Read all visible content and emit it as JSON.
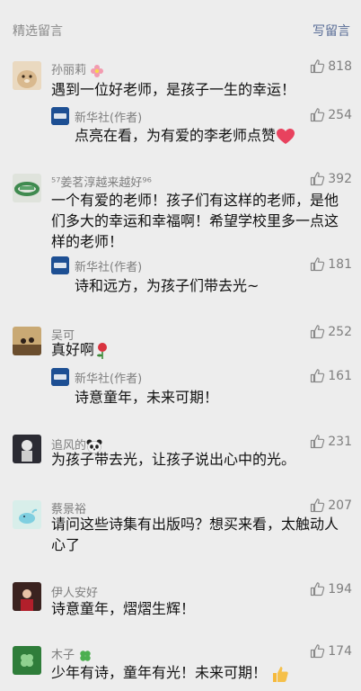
{
  "header": {
    "title": "精选留言",
    "write_label": "写留言"
  },
  "reply_author": "新华社(作者)",
  "comments": [
    {
      "author": "孙丽莉",
      "text": "遇到一位好老师，是孩子一生的幸运！",
      "likes": "818",
      "reply": {
        "text": "点亮在看，为有爱的李老师点赞",
        "likes": "254"
      }
    },
    {
      "author": "⁵⁷姜茗淳越来越好⁹⁶",
      "text": "一个有爱的老师！孩子们有这样的老师，是他们多大的幸运和幸福啊！希望学校里多一点这样的老师！",
      "likes": "392",
      "reply": {
        "text": "诗和远方，为孩子们带去光~",
        "likes": "181"
      }
    },
    {
      "author": "吴可",
      "text": "真好啊",
      "likes": "252",
      "reply": {
        "text": "诗意童年，未来可期！",
        "likes": "161"
      }
    },
    {
      "author": "追风的",
      "text": "为孩子带去光，让孩子说出心中的光。",
      "likes": "231"
    },
    {
      "author": "蔡景裕",
      "text": "请问这些诗集有出版吗？想买来看，太触动人心了",
      "likes": "207"
    },
    {
      "author": "伊人安好",
      "text": "诗意童年，熠熠生辉！",
      "likes": "194"
    },
    {
      "author": "木子",
      "text": "少年有诗，童年有光！未来可期！",
      "likes": "174"
    }
  ],
  "colors": {
    "background": "#ededed",
    "link": "#576b95",
    "meta": "#7f7f7f"
  },
  "icons": [
    "thumbs-up-icon",
    "flower-emoji",
    "heart-emoji",
    "rose-emoji",
    "panda-emoji",
    "clover-emoji",
    "thumbs-up-emoji"
  ]
}
